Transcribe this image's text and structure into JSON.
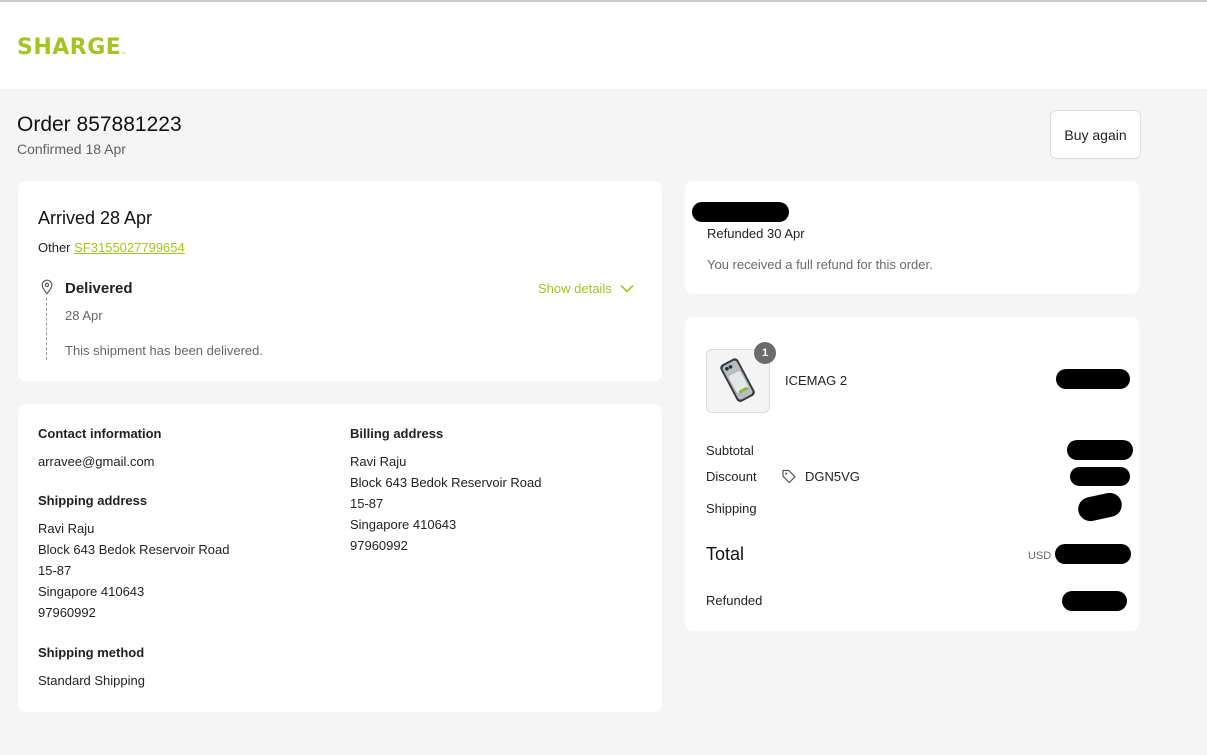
{
  "brand": {
    "name": "SHARGE",
    "mark": "™",
    "accent_color": "#a3c524"
  },
  "order": {
    "title": "Order 857881223",
    "confirmed": "Confirmed 18 Apr",
    "buy_again_label": "Buy again"
  },
  "shipment": {
    "status_title": "Arrived 28 Apr",
    "carrier_label": "Other",
    "tracking_number": "SF3155027799654",
    "event_status": "Delivered",
    "event_date": "28 Apr",
    "event_message": "This shipment has been delivered.",
    "show_details_label": "Show details",
    "icons": [
      "location-pin-icon",
      "chevron-down-icon"
    ]
  },
  "customer": {
    "contact_heading": "Contact information",
    "email": "arravee@gmail.com",
    "shipping_heading": "Shipping address",
    "shipping_address": {
      "name": "Ravi Raju",
      "line1": "Block 643 Bedok Reservoir Road",
      "line2": "15-87",
      "city": "Singapore 410643",
      "phone": "97960992"
    },
    "billing_heading": "Billing address",
    "billing_address": {
      "name": "Ravi Raju",
      "line1": "Block 643 Bedok Reservoir Road",
      "line2": "15-87",
      "city": "Singapore 410643",
      "phone": "97960992"
    },
    "method_heading": "Shipping method",
    "method": "Standard Shipping"
  },
  "refund": {
    "title": "Refunded 30 Apr",
    "message": "You received a full refund for this order."
  },
  "summary": {
    "items": [
      {
        "name": "ICEMAG 2",
        "quantity": "1"
      }
    ],
    "subtotal_label": "Subtotal",
    "discount_label": "Discount",
    "discount_code": "DGN5VG",
    "shipping_label": "Shipping",
    "total_label": "Total",
    "currency": "USD",
    "refunded_label": "Refunded",
    "icons": [
      "tag-icon"
    ]
  }
}
